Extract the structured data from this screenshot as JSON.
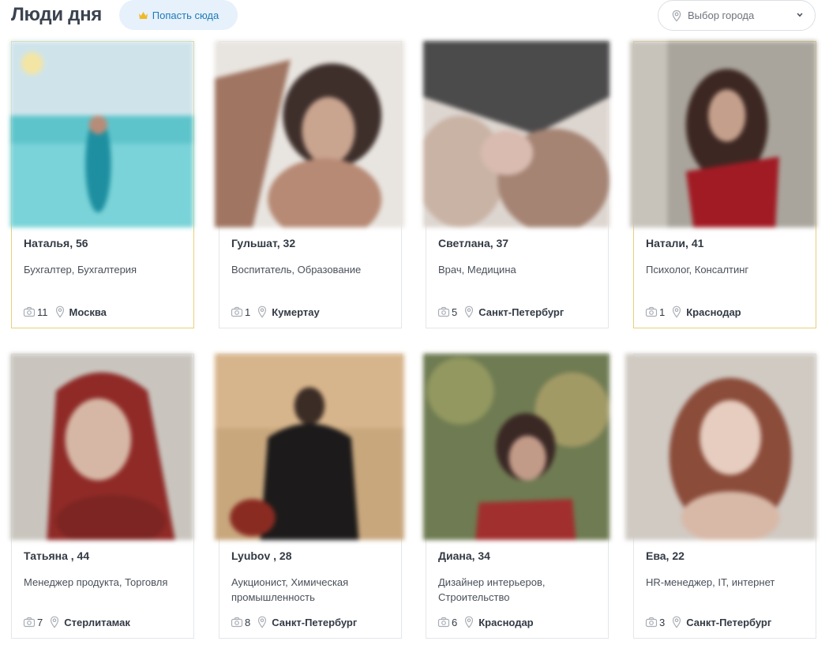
{
  "header": {
    "title": "Люди дня",
    "promo_button": "Попасть сюда",
    "city_select_placeholder": "Выбор города"
  },
  "colors": {
    "accent_blue": "#1f7ab8",
    "promo_bg": "#e6f1fb",
    "featured_border": "#e9cf7a",
    "crown": "#f1b92a"
  },
  "icons": {
    "promo": "crown-icon",
    "city_select": "location-pin-icon",
    "dropdown": "chevron-down-icon",
    "photos": "camera-icon",
    "city": "location-pin-icon"
  },
  "people": [
    {
      "name": "Наталья, 56",
      "job": "Бухгалтер, Бухгалтерия",
      "photos": "11",
      "city": "Москва",
      "featured": true
    },
    {
      "name": "Гульшат, 32",
      "job": "Воспитатель, Образование",
      "photos": "1",
      "city": "Кумертау",
      "featured": false
    },
    {
      "name": "Светлана, 37",
      "job": "Врач, Медицина",
      "photos": "5",
      "city": "Санкт-Петербург",
      "featured": false
    },
    {
      "name": "Натали, 41",
      "job": "Психолог, Консалтинг",
      "photos": "1",
      "city": "Краснодар",
      "featured": true
    },
    {
      "name": "Татьяна , 44",
      "job": "Менеджер продукта, Торговля",
      "photos": "7",
      "city": "Стерлитамак",
      "featured": false
    },
    {
      "name": "Lyubov , 28",
      "job": "Аукционист, Химическая промышленность",
      "photos": "8",
      "city": "Санкт-Петербург",
      "featured": false
    },
    {
      "name": "Диана, 34",
      "job": "Дизайнер интерьеров, Строительство",
      "photos": "6",
      "city": "Краснодар",
      "featured": false
    },
    {
      "name": "Ева, 22",
      "job": "HR-менеджер, IT, интернет",
      "photos": "3",
      "city": "Санкт-Петербург",
      "featured": false
    }
  ]
}
